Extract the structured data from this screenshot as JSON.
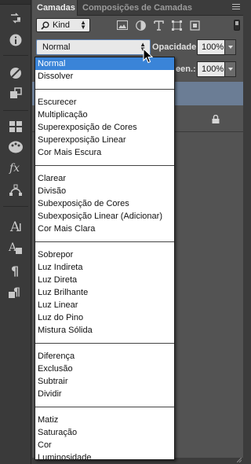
{
  "tabs": {
    "layers": "Camadas",
    "comps": "Composições de Camadas"
  },
  "filter": {
    "kind_label": "Kind",
    "icons": [
      "image-filter-icon",
      "adjustment-filter-icon",
      "type-filter-icon",
      "shape-filter-icon",
      "smart-object-filter-icon"
    ]
  },
  "blend": {
    "selected": "Normal",
    "opacity_label": "Opacidade:",
    "opacity_value": "100%",
    "fill_label": "een.:",
    "fill_value": "100%"
  },
  "blend_modes": [
    [
      "Normal",
      "Dissolver"
    ],
    [
      "Escurecer",
      "Multiplicação",
      "Superexposição de Cores",
      "Superexposição Linear",
      "Cor Mais Escura"
    ],
    [
      "Clarear",
      "Divisão",
      "Subexposição de Cores",
      "Subexposição Linear (Adicionar)",
      "Cor Mais Clara"
    ],
    [
      "Sobrepor",
      "Luz Indireta",
      "Luz Direta",
      "Luz Brilhante",
      "Luz Linear",
      "Luz do Pino",
      "Mistura Sólida"
    ],
    [
      "Diferença",
      "Exclusão",
      "Subtrair",
      "Dividir"
    ],
    [
      "Matiz",
      "Saturação",
      "Cor",
      "Luminosidade"
    ]
  ],
  "colors": {
    "selection": "#3a84d8",
    "panel": "#535353",
    "layer_selected": "#6b7d95"
  },
  "tools": [
    "swap-icon",
    "info-icon",
    "color-icon",
    "history-icon",
    "swatches-icon",
    "styles-icon",
    "fx-icon",
    "path-icon",
    "character-icon",
    "char-styles-icon",
    "paragraph-icon",
    "para-styles-icon"
  ]
}
